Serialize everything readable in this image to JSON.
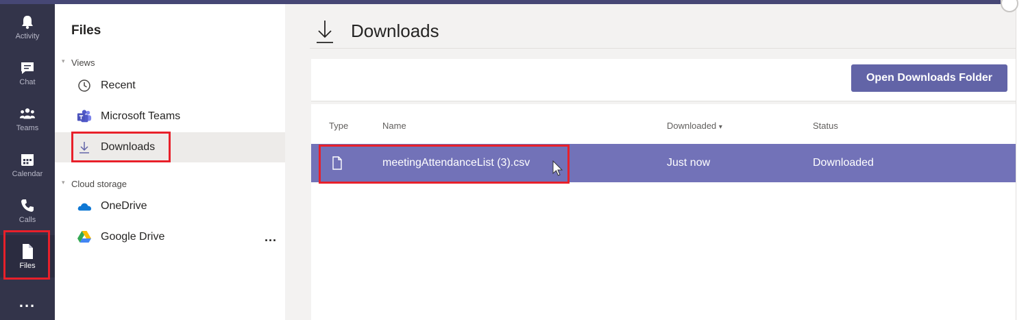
{
  "rail": {
    "items": [
      {
        "id": "activity",
        "label": "Activity",
        "icon": "bell-icon"
      },
      {
        "id": "chat",
        "label": "Chat",
        "icon": "chat-icon"
      },
      {
        "id": "teams",
        "label": "Teams",
        "icon": "teams-icon"
      },
      {
        "id": "calendar",
        "label": "Calendar",
        "icon": "calendar-icon"
      },
      {
        "id": "calls",
        "label": "Calls",
        "icon": "phone-icon"
      },
      {
        "id": "files",
        "label": "Files",
        "icon": "file-icon"
      }
    ],
    "more": "..."
  },
  "panel": {
    "title": "Files",
    "views_label": "Views",
    "views": [
      {
        "label": "Recent",
        "icon": "clock-icon"
      },
      {
        "label": "Microsoft Teams",
        "icon": "teams-logo-icon"
      },
      {
        "label": "Downloads",
        "icon": "download-icon"
      }
    ],
    "cloud_label": "Cloud storage",
    "cloud": [
      {
        "label": "OneDrive",
        "icon": "onedrive-icon"
      },
      {
        "label": "Google Drive",
        "icon": "google-drive-icon"
      }
    ],
    "more": "..."
  },
  "main": {
    "title": "Downloads",
    "open_button": "Open Downloads Folder",
    "columns": {
      "type": "Type",
      "name": "Name",
      "downloaded": "Downloaded",
      "status": "Status"
    },
    "rows": [
      {
        "name": "meetingAttendanceList (3).csv",
        "downloaded": "Just now",
        "status": "Downloaded"
      }
    ]
  },
  "colors": {
    "rail_bg": "#33344a",
    "accent": "#6264a7",
    "row_selected": "#7272b8",
    "highlight": "#e8202a"
  }
}
